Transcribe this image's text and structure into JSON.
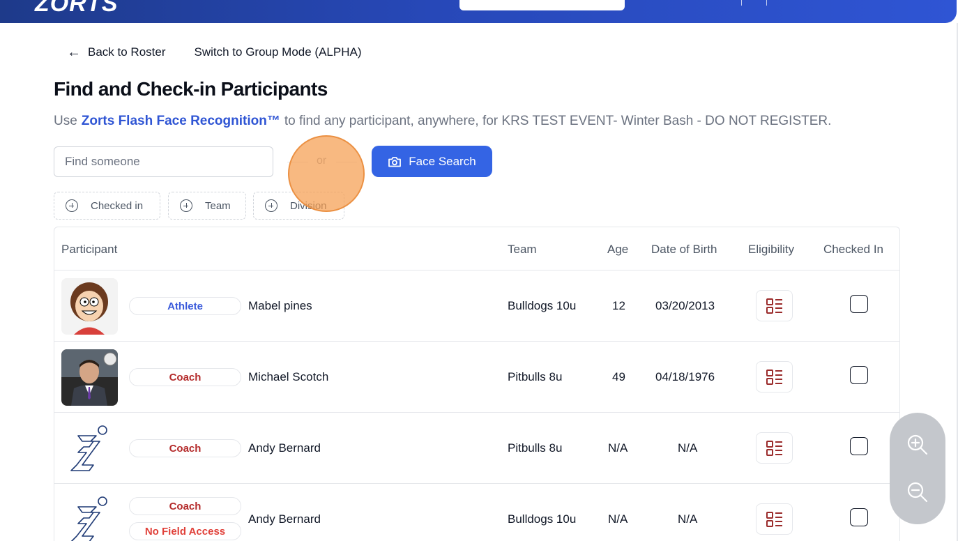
{
  "header": {
    "logo_text": "ZORTS"
  },
  "nav": {
    "back_label": "Back to Roster",
    "group_mode_label": "Switch to Group Mode (ALPHA)"
  },
  "page": {
    "title": "Find and Check-in Participants",
    "subtitle_prefix": "Use",
    "subtitle_brand": "Zorts Flash Face Recognition™",
    "subtitle_suffix": "to find any participant, anywhere, for KRS TEST EVENT- Winter Bash - DO NOT REGISTER."
  },
  "search": {
    "placeholder": "Find someone",
    "or_label": "or",
    "face_search_label": "Face Search"
  },
  "filters": [
    {
      "label": "Checked in"
    },
    {
      "label": "Team"
    },
    {
      "label": "Division"
    }
  ],
  "table": {
    "columns": [
      "Participant",
      "Team",
      "Age",
      "Date of Birth",
      "Eligibility",
      "Checked In"
    ],
    "rows": [
      {
        "role": "Athlete",
        "role_type": "athlete",
        "name": "Mabel pines",
        "team": "Bulldogs 10u",
        "age": "12",
        "dob": "03/20/2013",
        "checked": false
      },
      {
        "role": "Coach",
        "role_type": "coach",
        "name": "Michael Scotch",
        "team": "Pitbulls 8u",
        "age": "49",
        "dob": "04/18/1976",
        "checked": false
      },
      {
        "role": "Coach",
        "role_type": "coach",
        "name": "Andy Bernard",
        "team": "Pitbulls 8u",
        "age": "N/A",
        "dob": "N/A",
        "checked": false
      },
      {
        "role": "Coach",
        "role_type": "coach",
        "extra_badge": "No Field Access",
        "name": "Andy Bernard",
        "team": "Bulldogs 10u",
        "age": "N/A",
        "dob": "N/A",
        "checked": false
      }
    ]
  },
  "colors": {
    "primary": "#3464e4",
    "brand_text": "#2f55d4",
    "coach": "#b42b2b",
    "no_field_access": "#e0413a",
    "eligibility_icon": "#9b2c2c"
  },
  "icons": {
    "back": "arrow-left-icon",
    "camera": "camera-icon",
    "add_filter": "plus-circle-icon",
    "eligibility": "list-checklist-icon",
    "zoom_in": "zoom-in-icon",
    "zoom_out": "zoom-out-icon"
  }
}
